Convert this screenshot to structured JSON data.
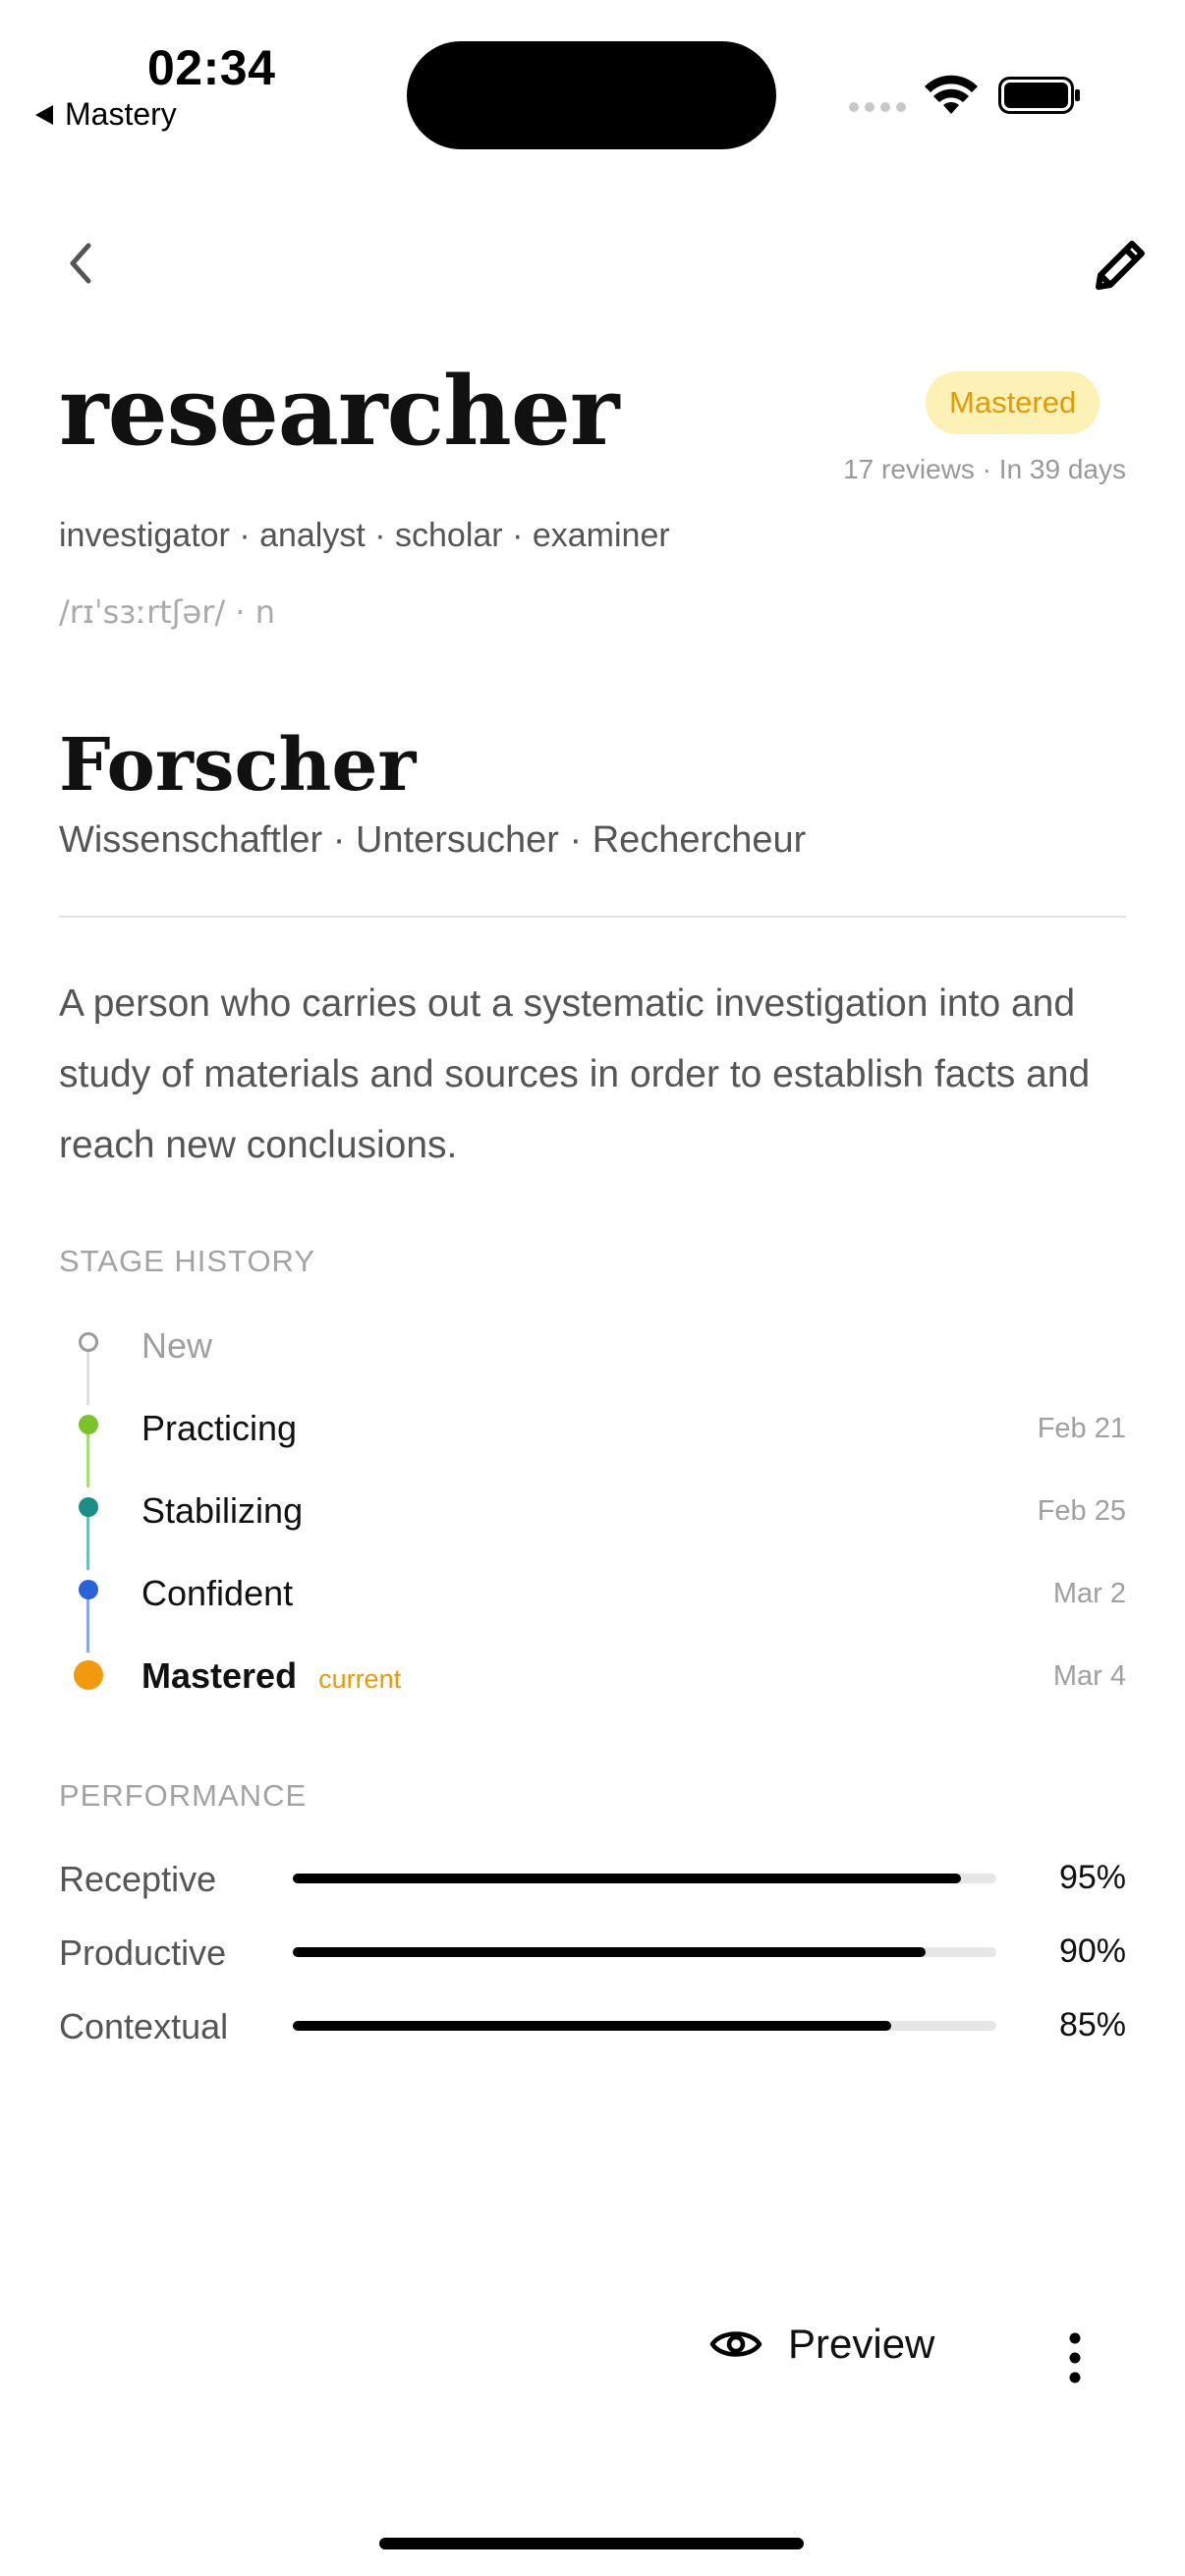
{
  "status_bar": {
    "time": "02:34",
    "back_app_label": "Mastery"
  },
  "nav": {
    "back_icon": "chevron-left-icon",
    "edit_icon": "pencil-icon"
  },
  "word": {
    "term": "researcher",
    "status_badge": "Mastered",
    "reviews_info": "17 reviews · In 39 days",
    "synonyms": "investigator · analyst · scholar · examiner",
    "pronunciation": "/rɪˈsɜːrtʃər/ · n"
  },
  "translation": {
    "main": "Forscher",
    "alternatives": "Wissenschaftler · Untersucher · Rechercheur"
  },
  "definition": "A person who carries out a systematic investigation into and study of materials and sources in order to establish facts and reach new conclusions.",
  "stage_history": {
    "title": "STAGE HISTORY",
    "stages": [
      {
        "label": "New",
        "date": "",
        "color": "#9a9a9a"
      },
      {
        "label": "Practicing",
        "date": "Feb 21",
        "color": "#7cc22a"
      },
      {
        "label": "Stabilizing",
        "date": "Feb 25",
        "color": "#1a8f86"
      },
      {
        "label": "Confident",
        "date": "Mar 2",
        "color": "#2a63d6"
      },
      {
        "label": "Mastered",
        "date": "Mar 4",
        "color": "#f29a0f",
        "current_label": "current"
      }
    ]
  },
  "performance": {
    "title": "PERFORMANCE",
    "metrics": [
      {
        "label": "Receptive",
        "percent_text": "95%",
        "value": 0.95
      },
      {
        "label": "Productive",
        "percent_text": "90%",
        "value": 0.9
      },
      {
        "label": "Contextual",
        "percent_text": "85%",
        "value": 0.85
      }
    ]
  },
  "actions": {
    "preview_label": "Preview",
    "preview_icon": "eye-icon",
    "more_icon": "more-vertical-icon"
  },
  "colors": {
    "badge_bg": "#fdf1b5",
    "badge_text": "#e29b08",
    "accent_orange": "#e89a0a"
  }
}
